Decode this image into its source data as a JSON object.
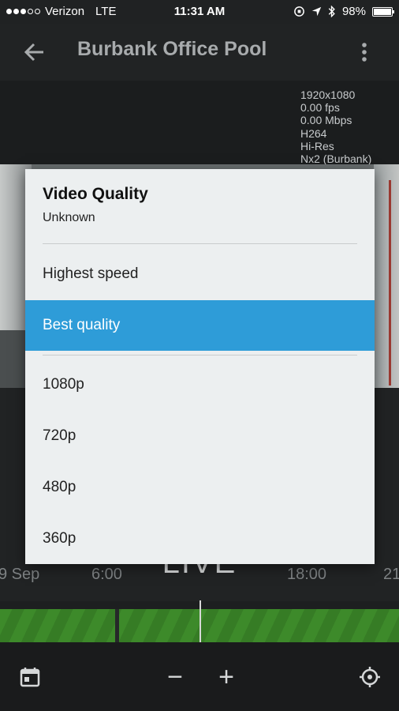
{
  "status_bar": {
    "carrier": "Verizon",
    "network": "LTE",
    "time": "11:31 AM",
    "battery": "98%",
    "battery_level": 0.98
  },
  "app_bar": {
    "title": "Burbank Office Pool"
  },
  "stream_stats": {
    "resolution": "1920x1080",
    "fps": "0.00 fps",
    "bitrate": "0.00 Mbps",
    "codec": "H264",
    "stream": "Hi-Res",
    "server": "Nx2 (Burbank)"
  },
  "timeline": {
    "live_label": "LIVE",
    "labels": [
      "9 Sep",
      "6:00",
      "18:00",
      "21"
    ]
  },
  "dialog": {
    "title": "Video Quality",
    "subtitle": "Unknown",
    "options": [
      {
        "label": "Highest speed",
        "selected": false
      },
      {
        "label": "Best quality",
        "selected": true
      },
      {
        "label": "1080p",
        "selected": false
      },
      {
        "label": "720p",
        "selected": false
      },
      {
        "label": "480p",
        "selected": false
      },
      {
        "label": "360p",
        "selected": false
      }
    ]
  },
  "bottom_bar": {
    "zoom_out": "−",
    "zoom_in": "+"
  },
  "colors": {
    "selected": "#2e9cd8",
    "timeline_green": "#3d8a2a"
  }
}
